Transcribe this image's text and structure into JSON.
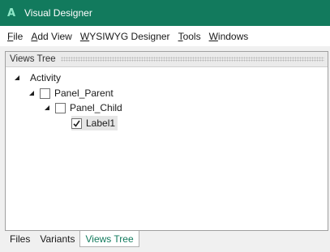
{
  "window": {
    "title": "Visual Designer",
    "icon": "A",
    "accent_color": "#127a5d"
  },
  "menubar": {
    "items": [
      {
        "label": "File",
        "mnemonic": "F",
        "rest": "ile"
      },
      {
        "label": "Add View",
        "mnemonic": "A",
        "rest": "dd View"
      },
      {
        "label": "WYSIWYG Designer",
        "mnemonic": "W",
        "rest": "YSIWYG Designer"
      },
      {
        "label": "Tools",
        "mnemonic": "T",
        "rest": "ools"
      },
      {
        "label": "Windows",
        "mnemonic": "W",
        "rest": "indows"
      }
    ]
  },
  "views_tree": {
    "header": "Views Tree",
    "nodes": [
      {
        "label": "Activity",
        "expanded": true,
        "has_checkbox": false,
        "checked": false
      },
      {
        "label": "Panel_Parent",
        "expanded": true,
        "has_checkbox": true,
        "checked": false
      },
      {
        "label": "Panel_Child",
        "expanded": true,
        "has_checkbox": true,
        "checked": false
      },
      {
        "label": "Label1",
        "expanded": false,
        "has_checkbox": true,
        "checked": true,
        "selected": true
      }
    ]
  },
  "bottom_tabs": {
    "items": [
      "Files",
      "Variants",
      "Views Tree"
    ],
    "active": "Views Tree"
  }
}
